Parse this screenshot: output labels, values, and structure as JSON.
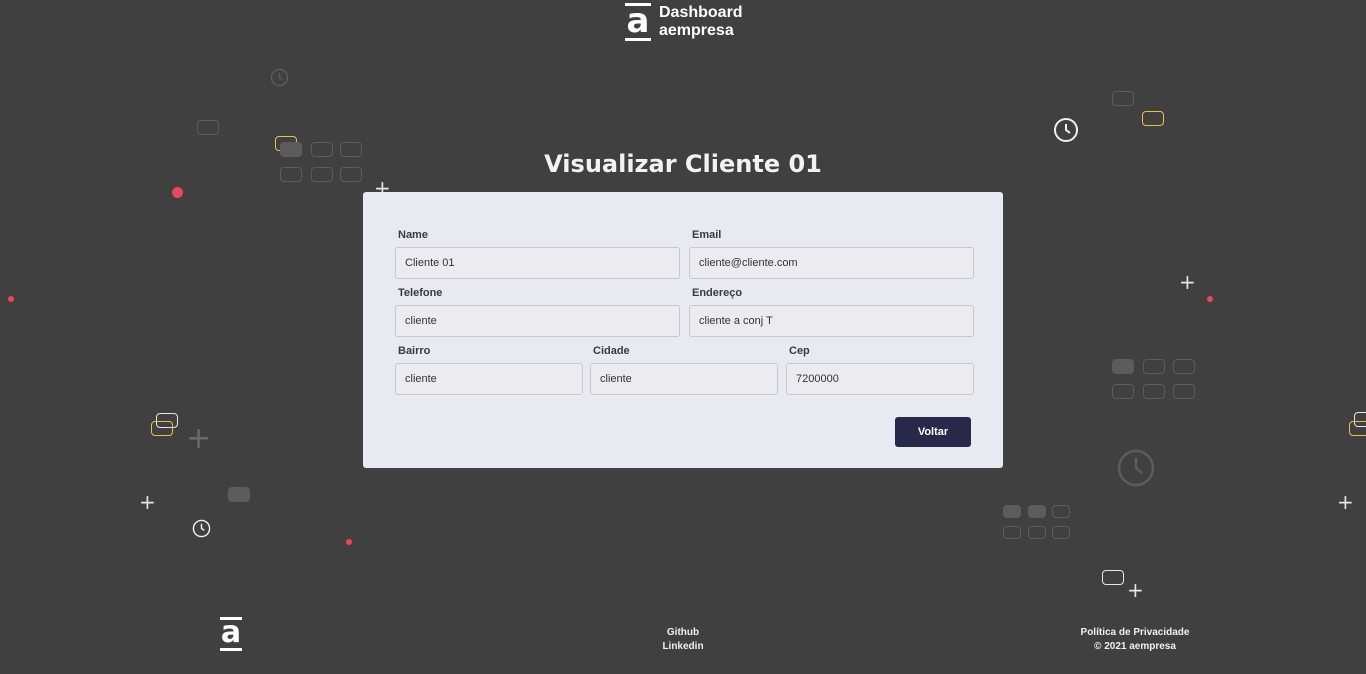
{
  "header": {
    "brand_line1": "Dashboard",
    "brand_line2": "aempresa",
    "logo_letter": "a"
  },
  "page_title": "Visualizar Cliente 01",
  "form": {
    "name_label": "Name",
    "name_value": "Cliente 01",
    "email_label": "Email",
    "email_value": "cliente@cliente.com",
    "telefone_label": "Telefone",
    "telefone_value": "cliente",
    "endereco_label": "Endereço",
    "endereco_value": "cliente a conj T",
    "bairro_label": "Bairro",
    "bairro_value": "cliente",
    "cidade_label": "Cidade",
    "cidade_value": "cliente",
    "cep_label": "Cep",
    "cep_value": "7200000",
    "back_button": "Voltar"
  },
  "footer": {
    "logo_letter": "a",
    "github": "Github",
    "linkedin": "Linkedin",
    "privacy": "Política de Privacidade",
    "copyright": "© 2021 aempresa"
  },
  "colors": {
    "background": "#404040",
    "card": "#e8eaf2",
    "button": "#28284a",
    "accent_yellow": "#e8c04a",
    "accent_red": "#e8485a"
  }
}
